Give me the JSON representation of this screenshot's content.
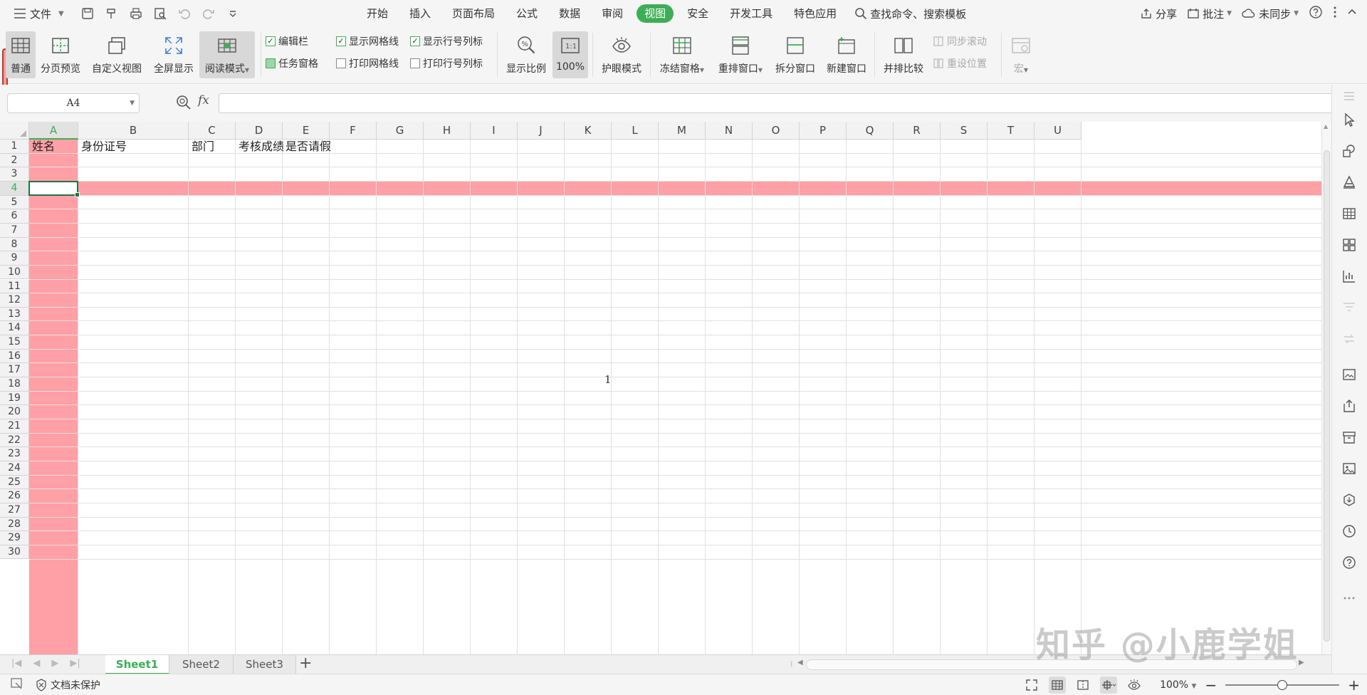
{
  "menubar": {
    "file_label": "文件",
    "tabs": [
      {
        "label": "开始",
        "active": false
      },
      {
        "label": "插入",
        "active": false
      },
      {
        "label": "页面布局",
        "active": false
      },
      {
        "label": "公式",
        "active": false
      },
      {
        "label": "数据",
        "active": false
      },
      {
        "label": "审阅",
        "active": false
      },
      {
        "label": "视图",
        "active": true
      },
      {
        "label": "安全",
        "active": false
      },
      {
        "label": "开发工具",
        "active": false
      },
      {
        "label": "特色应用",
        "active": false
      }
    ],
    "search_label": "查找命令、搜索模板",
    "share_label": "分享",
    "comment_label": "批注",
    "sync_label": "未同步"
  },
  "ribbon": {
    "normal": "普通",
    "page_preview": "分页预览",
    "custom_view": "自定义视图",
    "fullscreen": "全屏显示",
    "reading_mode": "阅读模式",
    "edit_bar": "编辑栏",
    "task_pane": "任务窗格",
    "show_gridlines": "显示网格线",
    "print_gridlines": "打印网格线",
    "show_headers": "显示行号列标",
    "print_headers": "打印行号列标",
    "zoom_ratio": "显示比例",
    "zoom_100": "100%",
    "zoom_100_icon_text": "1:1",
    "eye_mode": "护眼模式",
    "freeze_panes": "冻结窗格",
    "arrange_windows": "重排窗口",
    "split_window": "拆分窗口",
    "new_window": "新建窗口",
    "side_by_side": "并排比较",
    "sync_scroll": "同步滚动",
    "reset_position": "重设位置",
    "macro": "宏"
  },
  "formula": {
    "name_box": "A4",
    "fx_label": "fx",
    "value": ""
  },
  "grid": {
    "columns": [
      "A",
      "B",
      "C",
      "D",
      "E",
      "F",
      "G",
      "H",
      "I",
      "J",
      "K",
      "L",
      "M",
      "N",
      "O",
      "P",
      "Q",
      "R",
      "S",
      "T",
      "U"
    ],
    "rows": [
      "1",
      "2",
      "3",
      "4",
      "5",
      "6",
      "7",
      "8",
      "9",
      "10",
      "11",
      "12",
      "13",
      "14",
      "15",
      "16",
      "17",
      "18",
      "19",
      "20",
      "21",
      "22",
      "23",
      "24",
      "25",
      "26",
      "27",
      "28",
      "29",
      "30"
    ],
    "active_col": "A",
    "active_row": "4",
    "header_row": [
      "姓名",
      "身份证号",
      "部门",
      "考核成绩",
      "是否请假"
    ],
    "page_number": "1",
    "highlight_color": "#ffa0a6"
  },
  "sheets": [
    {
      "label": "Sheet1",
      "active": true
    },
    {
      "label": "Sheet2",
      "active": false
    },
    {
      "label": "Sheet3",
      "active": false
    }
  ],
  "add_sheet": "+",
  "status": {
    "protect_label": "文档未保护",
    "zoom_label": "100%",
    "zoom_level": 0.5
  },
  "watermark": "知乎 @小鹿学姐",
  "colors": {
    "accent": "#3dae55"
  }
}
